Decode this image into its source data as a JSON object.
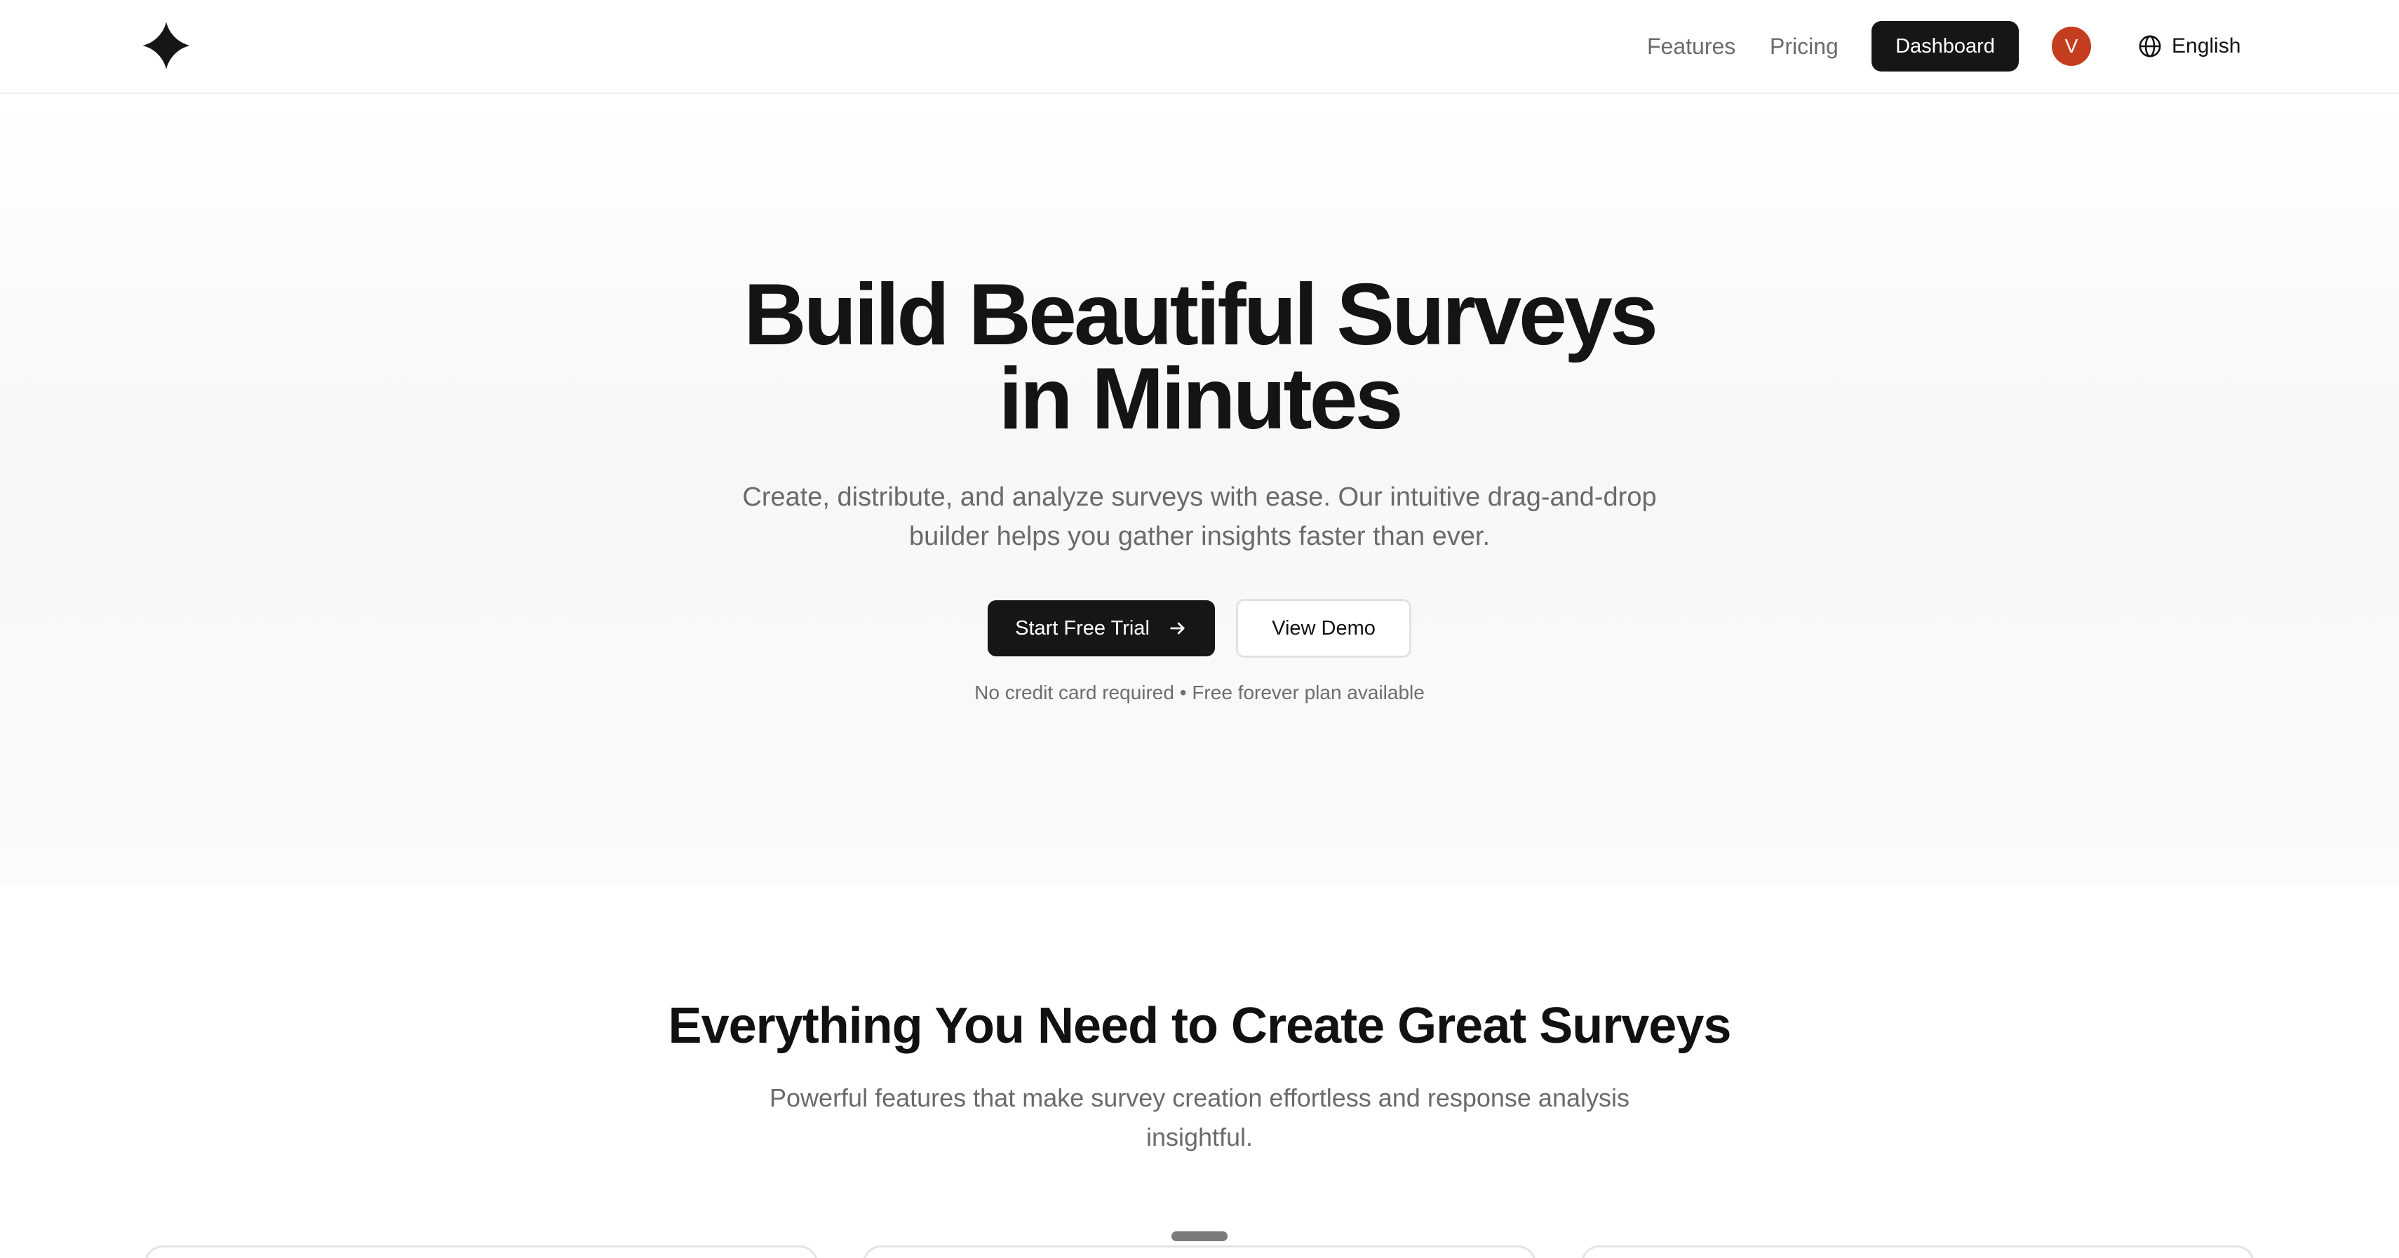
{
  "header": {
    "logo_icon": "sparkle-logo-icon",
    "nav": {
      "features": "Features",
      "pricing": "Pricing"
    },
    "dashboard_label": "Dashboard",
    "avatar_initial": "V",
    "avatar_color": "#c43d1e",
    "language": {
      "icon": "globe-icon",
      "label": "English"
    }
  },
  "hero": {
    "title_line1": "Build Beautiful Surveys",
    "title_line2": "in Minutes",
    "subtitle": "Create, distribute, and analyze surveys with ease. Our intuitive drag-and-drop builder helps you gather insights faster than ever.",
    "primary_cta": "Start Free Trial",
    "primary_cta_icon": "arrow-right-icon",
    "secondary_cta": "View Demo",
    "note": "No credit card required • Free forever plan available"
  },
  "features": {
    "title": "Everything You Need to Create Great Surveys",
    "subtitle": "Powerful features that make survey creation effortless and response analysis insightful."
  },
  "colors": {
    "primary": "#161616",
    "muted_text": "#6a6a6a",
    "border": "#e4e4e4"
  }
}
